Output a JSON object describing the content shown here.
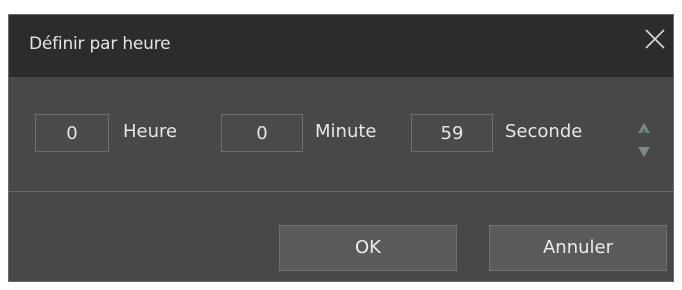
{
  "dialog": {
    "title": "Définir par heure",
    "close_icon": "close-icon"
  },
  "time": {
    "hours_value": "0",
    "hours_label": "Heure",
    "minutes_value": "0",
    "minutes_label": "Minute",
    "seconds_value": "59",
    "seconds_label": "Seconde",
    "spinner_up_icon": "triangle-up-icon",
    "spinner_down_icon": "triangle-down-icon"
  },
  "buttons": {
    "ok_label": "OK",
    "cancel_label": "Annuler"
  },
  "colors": {
    "titlebar_bg": "#2c2c2c",
    "body_bg": "#484848",
    "button_bg": "#5a5a5a",
    "text": "#e6e6e6"
  }
}
